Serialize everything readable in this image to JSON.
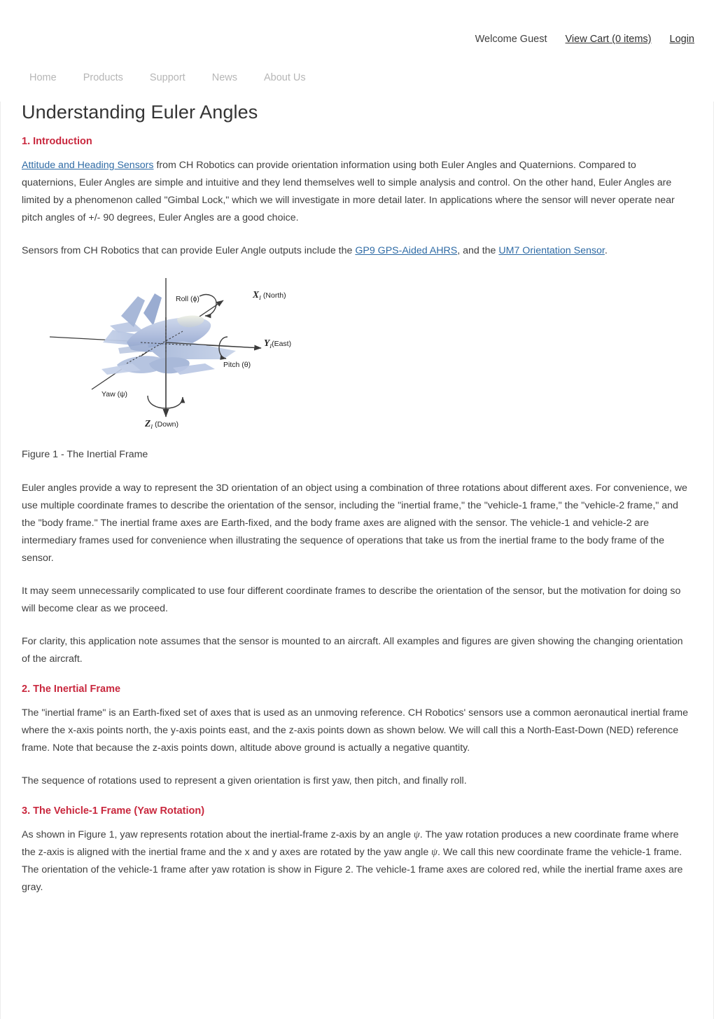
{
  "topbar": {
    "welcome": "Welcome Guest",
    "cart_link": "View Cart (0 items)",
    "login_link": "Login"
  },
  "nav": {
    "items": [
      {
        "label": "Home"
      },
      {
        "label": "Products"
      },
      {
        "label": "Support"
      },
      {
        "label": "News"
      },
      {
        "label": "About Us"
      }
    ]
  },
  "page": {
    "title": "Understanding Euler Angles"
  },
  "sections": {
    "intro": {
      "heading": "1. Introduction",
      "p1_link": "Attitude and Heading Sensors",
      "p1_rest": " from CH Robotics can provide orientation information using both Euler Angles and Quaternions.  Compared to quaternions, Euler Angles are simple and intuitive and they lend themselves well to simple analysis and control.  On the other hand, Euler Angles are limited by a phenomenon called \"Gimbal Lock,\" which we will investigate in more detail later.  In applications where the sensor will never operate near pitch angles of +/- 90 degrees, Euler Angles are a good choice.",
      "p2_a": "Sensors from CH Robotics that can provide Euler Angle outputs include the ",
      "p2_link1": "GP9 GPS-Aided AHRS",
      "p2_b": ", and the ",
      "p2_link2": "UM7 Orientation Sensor",
      "p2_c": ".",
      "p3": "Euler angles provide a way to represent the 3D orientation of an object using a combination of three rotations about different axes.  For convenience, we use multiple coordinate frames to describe the orientation of the sensor, including the \"inertial frame,\" the \"vehicle-1 frame,\" the \"vehicle-2 frame,\" and the \"body frame.\"  The inertial frame axes are Earth-fixed, and the body frame axes are aligned with the sensor.  The vehicle-1 and vehicle-2 are intermediary frames used for convenience when illustrating the sequence of operations that take us from the inertial frame to the body frame of the sensor.",
      "p4": "It may seem unnecessarily complicated to use four different coordinate frames to describe the orientation of the sensor, but the motivation for doing so will become clear as we proceed.",
      "p5": "For clarity, this application note assumes that the sensor is mounted to an aircraft.  All examples and figures are given showing the changing orientation of the aircraft."
    },
    "inertial": {
      "heading": "2. The Inertial Frame",
      "p1": "The \"inertial frame\" is an Earth-fixed set of axes that is used as an unmoving reference.  CH Robotics' sensors use a common aeronautical inertial frame where the x-axis points north, the y-axis points east, and the z-axis points down as shown below.  We will call this a North-East-Down (NED) reference frame.  Note that because the z-axis points down, altitude above ground is actually a negative quantity.",
      "p2": "The sequence of rotations used to represent a given orientation is first yaw, then pitch, and finally roll."
    },
    "vehicle1": {
      "heading": "3. The Vehicle-1 Frame (Yaw Rotation)",
      "p1_a": "As shown in Figure 1, yaw represents rotation about the inertial-frame z-axis by an angle ",
      "p1_psi1": "ψ",
      "p1_b": ".  The yaw rotation produces a new coordinate frame where the z-axis is aligned with the inertial frame and the x and y axes are rotated by the yaw angle ",
      "p1_psi2": "ψ",
      "p1_c": ".  We call this new coordinate frame the vehicle-1 frame.  The orientation of the vehicle-1 frame after yaw rotation is show in Figure 2.  The vehicle-1 frame axes are colored red, while the inertial frame axes are gray."
    }
  },
  "figure1": {
    "caption": "Figure 1 - The Inertial Frame",
    "labels": {
      "roll": "Roll (ϕ)",
      "pitch": "Pitch (θ)",
      "yaw": "Yaw (ψ)",
      "x_axis": "X",
      "x_sub": "I",
      "x_note": "(North)",
      "y_axis": "Y",
      "y_sub": "I",
      "y_note": "(East)",
      "z_axis": "Z",
      "z_sub": "I",
      "z_note": "(Down)"
    },
    "colors": {
      "aircraft_body": "#a9bbdd",
      "aircraft_light": "#c7d3e9",
      "aircraft_dark": "#8fa3cb",
      "axis": "#444444"
    }
  },
  "theme": {
    "accent_red": "#c9283e",
    "link_blue": "#2f6ba5",
    "nav_gray": "#b6b6b6",
    "text_gray": "#3f3f3f",
    "border_gray": "#ececec"
  }
}
